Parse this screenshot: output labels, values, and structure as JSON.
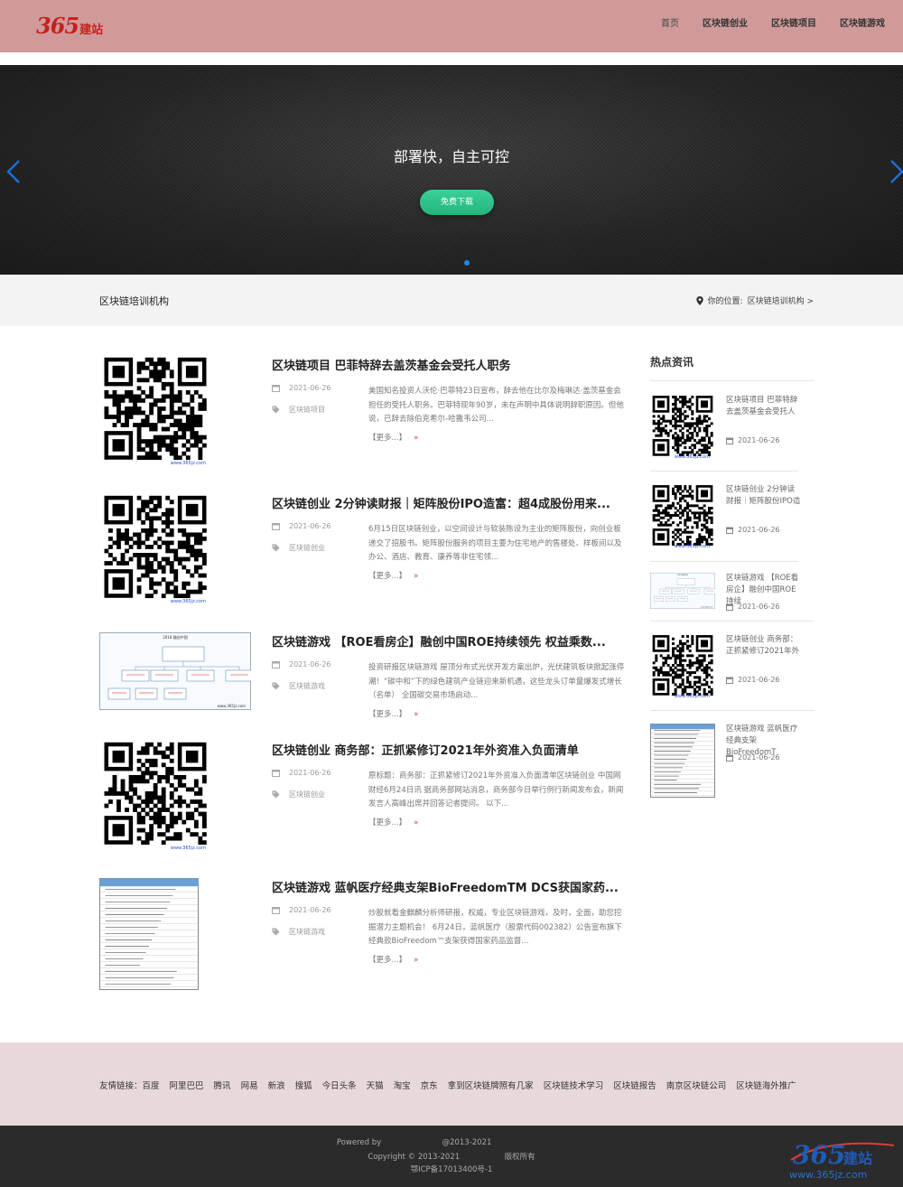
{
  "header": {
    "logo_number": "365",
    "logo_text": "建站",
    "nav": [
      "首页",
      "区块链创业",
      "区块链项目",
      "区块链游戏"
    ]
  },
  "banner": {
    "title": "部署快，自主可控",
    "button_label": "免费下载"
  },
  "breadcrumb": {
    "title": "区块链培训机构",
    "location_prefix": "你的位置:",
    "location": "区块链培训机构 >"
  },
  "articles": [
    {
      "title": "区块链项目 巴菲特辞去盖茨基金会受托人职务",
      "date": "2021-06-26",
      "tag": "区块链项目",
      "desc": "美国知名投资人沃伦·巴菲特23日宣布，辞去他在比尔及梅琳达·盖茨基金会担任的受托人职务。巴菲特现年90岁，未在声明中具体说明辞职原因。但他说，已辞去除伯克希尔-哈撒韦公司...",
      "more": "【更多...】",
      "thumb": "qr"
    },
    {
      "title": "区块链创业 2分钟读财报｜矩阵股份IPO造富：超4成股份用来...",
      "date": "2021-06-26",
      "tag": "区块链创业",
      "desc": "6月15日区块链创业，以空间设计与软装陈设为主业的矩阵股份，向创业板递交了招股书。矩阵股份服务的项目主要为住宅地产的售楼处、样板间以及办公、酒店、教育、康养等非住宅领...",
      "more": "【更多...】",
      "thumb": "qr"
    },
    {
      "title": "区块链游戏 【ROE看房企】融创中国ROE持续领先 权益乘数...",
      "date": "2021-06-26",
      "tag": "区块链游戏",
      "desc": "投资研报区块链游戏 屋顶分布式光伏开发方案出炉，光伏建筑板块掀起涨停潮！“碳中和”下的绿色建筑产业链迎来新机遇，这些龙头订单量爆发式增长（名单） 全国碳交易市场启动...",
      "more": "【更多...】",
      "thumb": "diagram"
    },
    {
      "title": "区块链创业 商务部：正抓紧修订2021年外资准入负面清单",
      "date": "2021-06-26",
      "tag": "区块链创业",
      "desc": "原标题：商务部：正抓紧修订2021年外资准入负面清单区块链创业 中国网财经6月24日讯 据商务部网站消息，商务部今日举行例行新闻发布会，新闻发言人高峰出席并回答记者提问。 以下...",
      "more": "【更多...】",
      "thumb": "qr"
    },
    {
      "title": "区块链游戏 蓝帆医疗经典支架BioFreedomTM DCS获国家药...",
      "date": "2021-06-26",
      "tag": "区块链游戏",
      "desc": "炒股就看金麒麟分析师研报，权威，专业区块链游戏，及时，全面，助您挖掘潜力主题机会！ 6月24日，蓝帆医疗（股票代码002382）公告宣布旗下经典款BioFreedom™支架获得国家药品监督...",
      "more": "【更多...】",
      "thumb": "list"
    }
  ],
  "sidebar": {
    "title": "热点资讯",
    "items": [
      {
        "text": "区块链项目 巴菲特辞去盖茨基金会受托人",
        "date": "2021-06-26",
        "thumb": "qr"
      },
      {
        "text": "区块链创业 2分钟读财报｜矩阵股份IPO造",
        "date": "2021-06-26",
        "thumb": "qr"
      },
      {
        "text": "区块链游戏 【ROE看房企】融创中国ROE持续",
        "date": "2021-06-26",
        "thumb": "diagram"
      },
      {
        "text": "区块链创业 商务部：正抓紧修订2021年外",
        "date": "2021-06-26",
        "thumb": "qr"
      },
      {
        "text": "区块链游戏 蓝帆医疗经典支架BioFreedomT",
        "date": "2021-06-26",
        "thumb": "list"
      }
    ]
  },
  "footer_links": {
    "label": "友情链接：",
    "links": [
      "百度",
      "阿里巴巴",
      "腾讯",
      "网易",
      "新浪",
      "搜狐",
      "今日头条",
      "天猫",
      "淘宝",
      "京东",
      "拿到区块链牌照有几家",
      "区块链技术学习",
      "区块链报告",
      "南京区块链公司",
      "区块链海外推广"
    ]
  },
  "footer": {
    "powered": "Powered by",
    "copyright_year": "@2013-2021",
    "copyright": "Copyright © 2013-2021",
    "rights": "版权所有",
    "icp": "鄂ICP备17013400号-1"
  },
  "watermark": {
    "text": "www.365jz.com"
  }
}
